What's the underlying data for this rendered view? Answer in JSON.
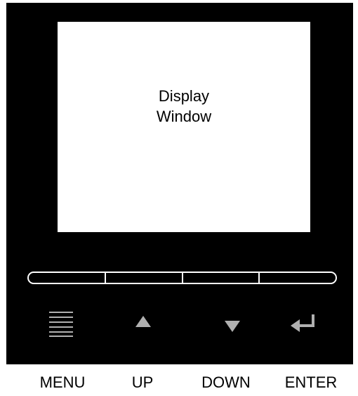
{
  "display": {
    "line1": "Display",
    "line2": "Window"
  },
  "buttons": [
    {
      "label": "MENU",
      "icon": "menu-icon"
    },
    {
      "label": "UP",
      "icon": "up-arrow-icon"
    },
    {
      "label": "DOWN",
      "icon": "down-arrow-icon"
    },
    {
      "label": "ENTER",
      "icon": "enter-icon"
    }
  ],
  "colors": {
    "panel": "#000000",
    "screen": "#ffffff",
    "icon": "#b0b0b0"
  }
}
